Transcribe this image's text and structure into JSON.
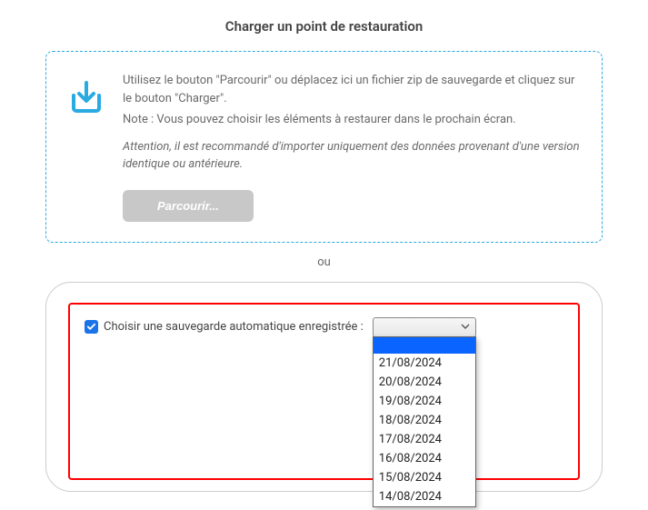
{
  "title": "Charger un point de restauration",
  "upload": {
    "line1": "Utilisez le bouton \"Parcourir\" ou déplacez ici un fichier zip de sauvegarde et cliquez sur le bouton \"Charger\".",
    "line2": "Note : Vous pouvez choisir les éléments à restaurer dans le prochain écran.",
    "warning": "Attention, il est recommandé d'importer uniquement des données provenant d'une version identique ou antérieure.",
    "browse_label": "Parcourir..."
  },
  "or_label": "ou",
  "choose": {
    "label": "Choisir une sauvegarde automatique enregistrée :",
    "checked": true,
    "options": [
      "",
      "21/08/2024",
      "20/08/2024",
      "19/08/2024",
      "18/08/2024",
      "17/08/2024",
      "16/08/2024",
      "15/08/2024",
      "14/08/2024"
    ]
  },
  "colors": {
    "accent": "#29abe2",
    "danger": "#ff0000",
    "primary": "#1a73e8"
  }
}
